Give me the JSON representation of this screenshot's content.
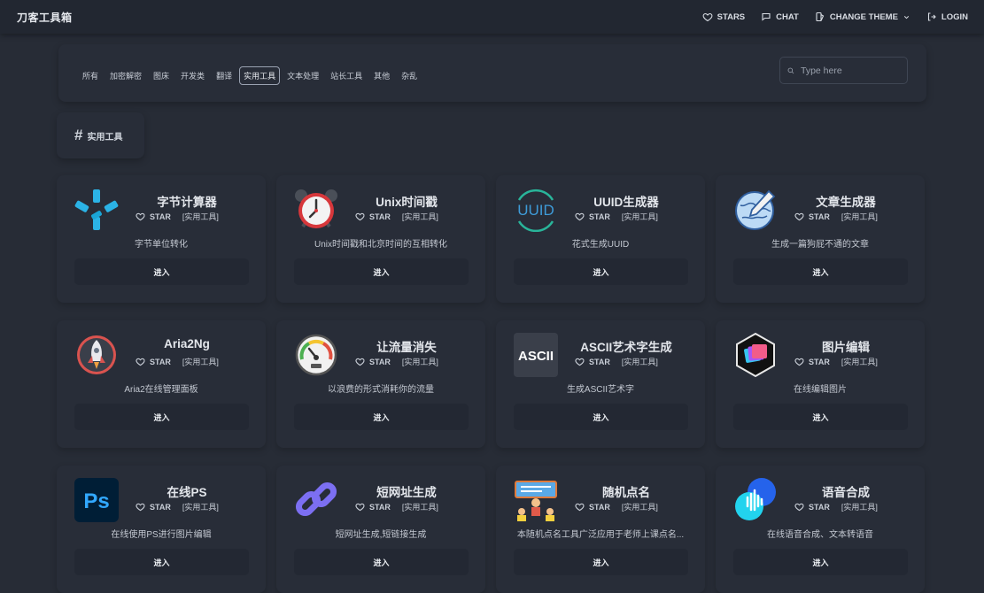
{
  "header": {
    "brand": "刀客工具箱",
    "nav": [
      {
        "label": "STARS",
        "icon": "heart-icon"
      },
      {
        "label": "CHAT",
        "icon": "chat-icon"
      },
      {
        "label": "CHANGE THEME",
        "icon": "theme-icon"
      },
      {
        "label": "LOGIN",
        "icon": "login-icon"
      }
    ]
  },
  "filter": {
    "tabs": [
      "所有",
      "加密解密",
      "图床",
      "开发类",
      "翻译",
      "实用工具",
      "文本处理",
      "站长工具",
      "其他",
      "杂乱"
    ],
    "active_tab": "实用工具",
    "search_placeholder": "Type here"
  },
  "category": {
    "hash": "#",
    "label": "实用工具"
  },
  "cards": [
    {
      "title": "字节计算器",
      "star": "STAR",
      "tag": "[实用工具]",
      "desc": "字节单位转化",
      "button": "进入",
      "icon": "asterisk-logo-icon"
    },
    {
      "title": "Unix时间戳",
      "star": "STAR",
      "tag": "[实用工具]",
      "desc": "Unix时间戳和北京时间的互相转化",
      "button": "进入",
      "icon": "alarm-clock-icon"
    },
    {
      "title": "UUID生成器",
      "star": "STAR",
      "tag": "[实用工具]",
      "desc": "花式生成UUID",
      "button": "进入",
      "icon": "uuid-logo-icon",
      "logo_text": "UUID"
    },
    {
      "title": "文章生成器",
      "star": "STAR",
      "tag": "[实用工具]",
      "desc": "生成一篇狗屁不通的文章",
      "button": "进入",
      "icon": "globe-pencil-icon"
    },
    {
      "title": "Aria2Ng",
      "star": "STAR",
      "tag": "[实用工具]",
      "desc": "Aria2在线管理面板",
      "button": "进入",
      "icon": "rocket-icon"
    },
    {
      "title": "让流量消失",
      "star": "STAR",
      "tag": "[实用工具]",
      "desc": "以浪费的形式消耗你的流量",
      "button": "进入",
      "icon": "speedometer-icon"
    },
    {
      "title": "ASCII艺术字生成",
      "star": "STAR",
      "tag": "[实用工具]",
      "desc": "生成ASCII艺术字",
      "button": "进入",
      "icon": "ascii-logo-icon",
      "logo_text": "ASCII"
    },
    {
      "title": "图片编辑",
      "star": "STAR",
      "tag": "[实用工具]",
      "desc": "在线编辑图片",
      "button": "进入",
      "icon": "image-editor-icon"
    },
    {
      "title": "在线PS",
      "star": "STAR",
      "tag": "[实用工具]",
      "desc": "在线使用PS进行图片编辑",
      "button": "进入",
      "icon": "photoshop-icon",
      "logo_text": "Ps"
    },
    {
      "title": "短网址生成",
      "star": "STAR",
      "tag": "[实用工具]",
      "desc": "短网址生成,短链接生成",
      "button": "进入",
      "icon": "link-icon"
    },
    {
      "title": "随机点名",
      "star": "STAR",
      "tag": "[实用工具]",
      "desc": "本随机点名工具广泛应用于老师上课点名...",
      "button": "进入",
      "icon": "classroom-icon"
    },
    {
      "title": "语音合成",
      "star": "STAR",
      "tag": "[实用工具]",
      "desc": "在线语音合成、文本转语音",
      "button": "进入",
      "icon": "voice-wave-icon"
    }
  ],
  "colors": {
    "background": "#272c36",
    "card": "#282d38",
    "button": "#232833"
  }
}
